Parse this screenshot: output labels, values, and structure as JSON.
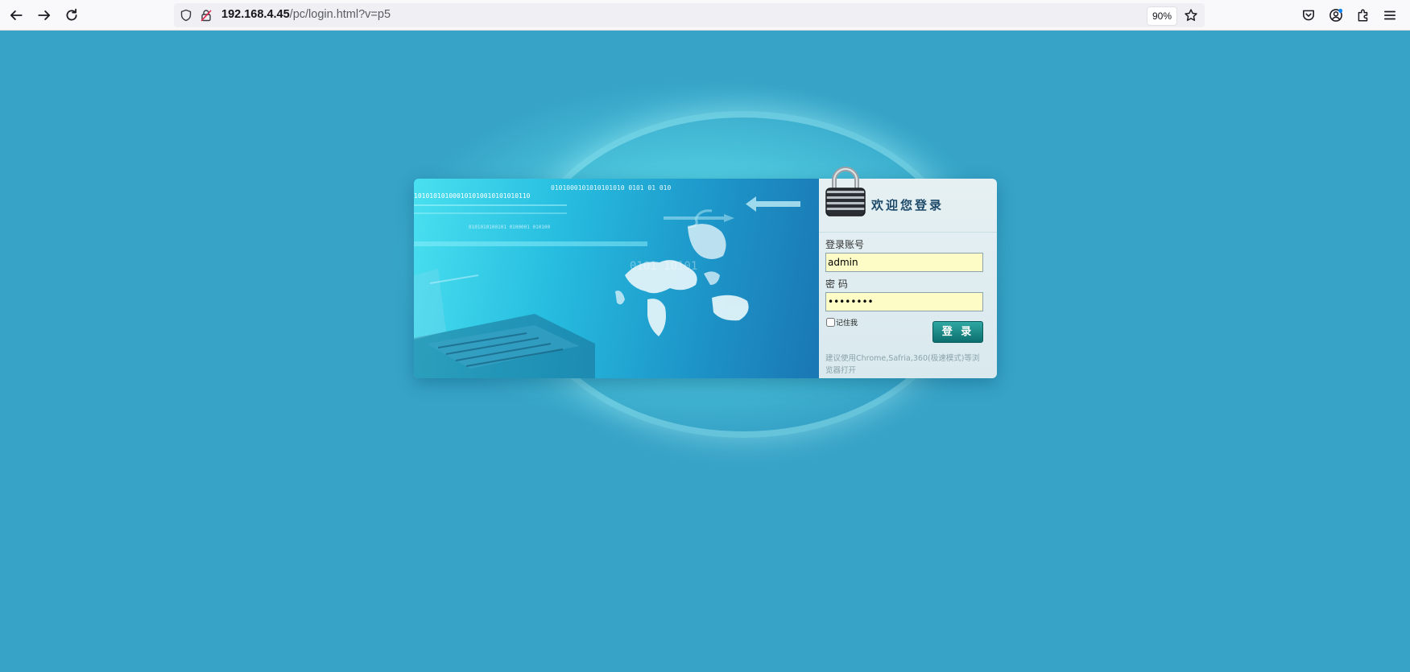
{
  "browser": {
    "url_host": "192.168.4.45",
    "url_path": "/pc/login.html?v=p5",
    "zoom": "90%",
    "icons": [
      "back-arrow-icon",
      "forward-arrow-icon",
      "reload-icon",
      "shield-icon",
      "insecure-lock-icon",
      "bookmark-star-icon",
      "pocket-icon",
      "account-icon",
      "extensions-icon",
      "menu-icon"
    ]
  },
  "page": {
    "background_color": "#36a3c7",
    "banner_binary_lines": [
      "0101000101010101010     0101   01 010",
      "101010101000101010010101010110",
      "0101010100101 0100001 010100"
    ],
    "banner_watermark": "0101 10101"
  },
  "login": {
    "welcome": "欢迎您登录",
    "account_label": "登录账号",
    "account_value": "admin",
    "password_label": "密 码",
    "password_value": "••••••••",
    "remember_label": "记住我",
    "submit_label": "登 录",
    "tip": "建议使用Chrome,Safria,360(极速模式)等浏览器打开",
    "button_color": "#0b6f6e",
    "input_bg": "#fdfcc7"
  }
}
